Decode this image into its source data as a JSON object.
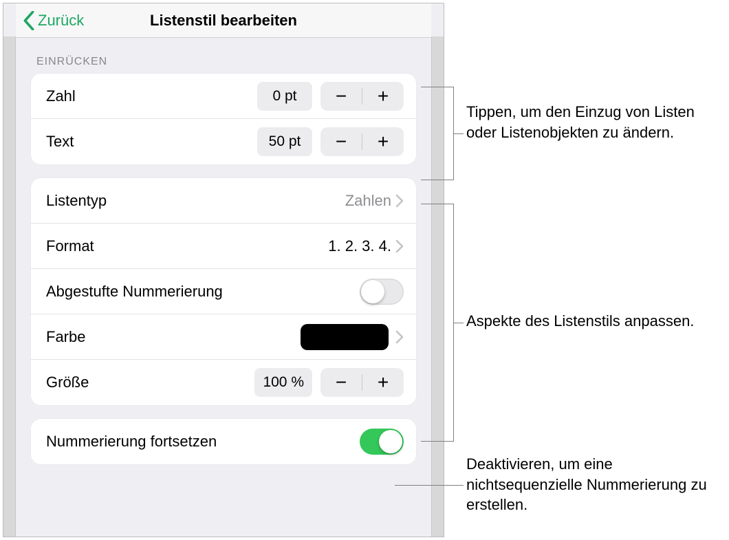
{
  "nav": {
    "back_label": "Zurück",
    "title": "Listenstil bearbeiten"
  },
  "section_indent_header": "EINRÜCKEN",
  "indent": {
    "zahl": {
      "label": "Zahl",
      "value": "0 pt"
    },
    "text": {
      "label": "Text",
      "value": "50 pt"
    }
  },
  "style": {
    "listentyp": {
      "label": "Listentyp",
      "value": "Zahlen"
    },
    "format": {
      "label": "Format",
      "value": "1. 2. 3. 4."
    },
    "abgestufte": {
      "label": "Abgestufte Nummerierung"
    },
    "farbe": {
      "label": "Farbe"
    },
    "groesse": {
      "label": "Größe",
      "value": "100 %"
    }
  },
  "continue": {
    "label": "Nummerierung fortsetzen"
  },
  "glyphs": {
    "minus": "−",
    "plus": "+"
  },
  "callouts": {
    "c1": "Tippen, um den Einzug von Listen oder Listenobjekten zu ändern.",
    "c2": "Aspekte des Listenstils anpassen.",
    "c3": "Deaktivieren, um eine nichtsequenzielle Nummerierung zu erstellen."
  }
}
